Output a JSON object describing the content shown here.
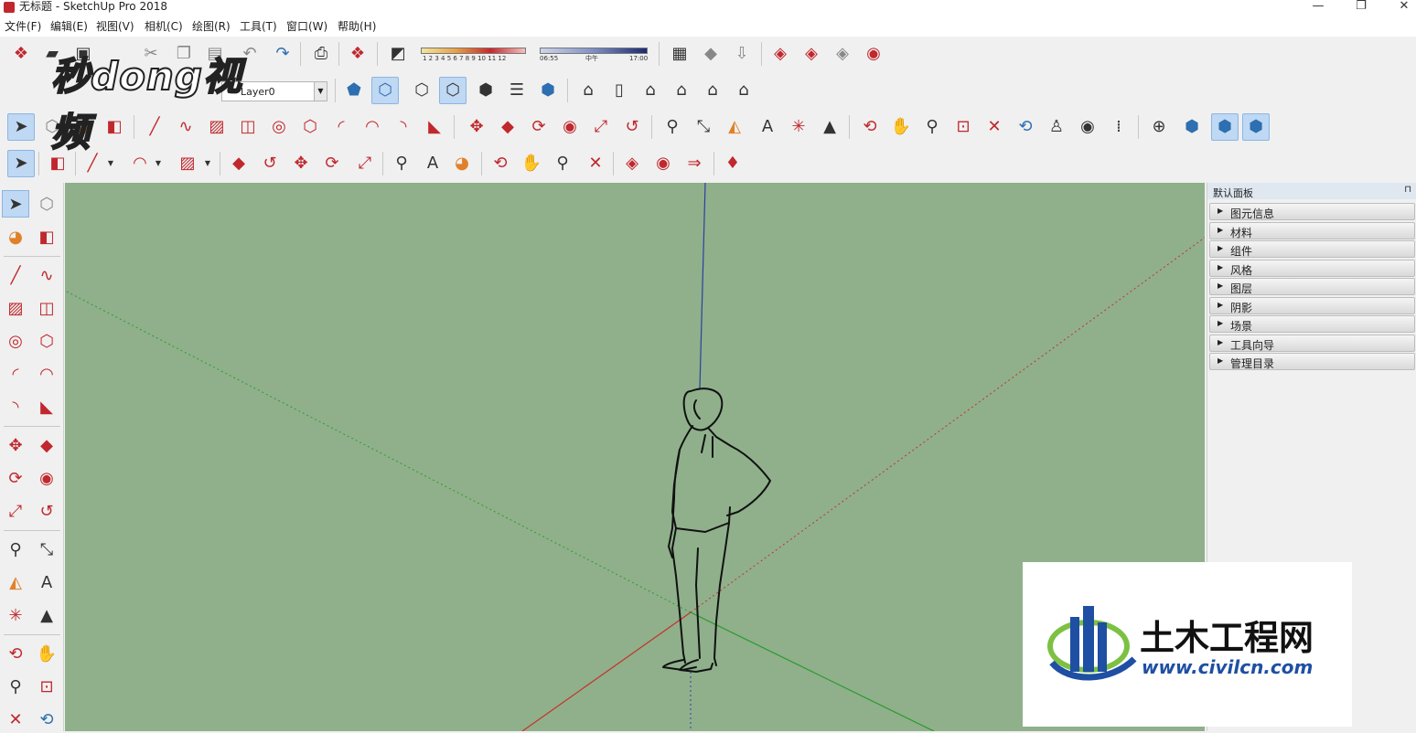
{
  "window": {
    "title": "无标题 - SketchUp Pro 2018",
    "minimize_glyph": "—",
    "maximize_glyph": "❐",
    "close_glyph": "✕"
  },
  "menu": [
    "文件(F)",
    "编辑(E)",
    "视图(V)",
    "相机(C)",
    "绘图(R)",
    "工具(T)",
    "窗口(W)",
    "帮助(H)"
  ],
  "shadow_settings": {
    "months": "1 2 3 4 5 6 7 8 9 10 11 12",
    "time_start": "06:55",
    "time_noon": "中午",
    "time_end": "17:00"
  },
  "layer": {
    "current": "Layer0",
    "check": "✓"
  },
  "tray": {
    "title": "默认面板",
    "pin": "⊓",
    "panels": [
      "图元信息",
      "材料",
      "组件",
      "风格",
      "图层",
      "阴影",
      "场景",
      "工具向导",
      "管理目录"
    ]
  },
  "watermarks": {
    "top_left": "秒dong视频",
    "brand_cn": "土木工程网",
    "brand_url": "www.civilcn.com"
  },
  "colors": {
    "viewport_bg": "#8fb08b",
    "axis_red": "#c4322d",
    "axis_green": "#2c9b2e",
    "axis_blue": "#2d3fa0",
    "brand_blue": "#1e4fa3",
    "brand_green": "#7cc142"
  },
  "icons": {
    "toolbar1": [
      "sketchup-new-icon",
      "open-icon",
      "save-icon",
      "cut-icon",
      "copy-icon",
      "paste-icon",
      "erase-icon",
      "undo-icon",
      "redo-icon",
      "print-icon",
      "model-info-icon"
    ],
    "toolbar_shadow": [
      "shadow-toggle-icon"
    ],
    "toolbar_warehouse": [
      "warehouse-icon",
      "share-icon",
      "extension-icon"
    ],
    "toolbar_ruby": [
      "ruby-icon-1",
      "ruby-icon-2",
      "ruby-icon-3",
      "ruby-icon-4"
    ]
  }
}
